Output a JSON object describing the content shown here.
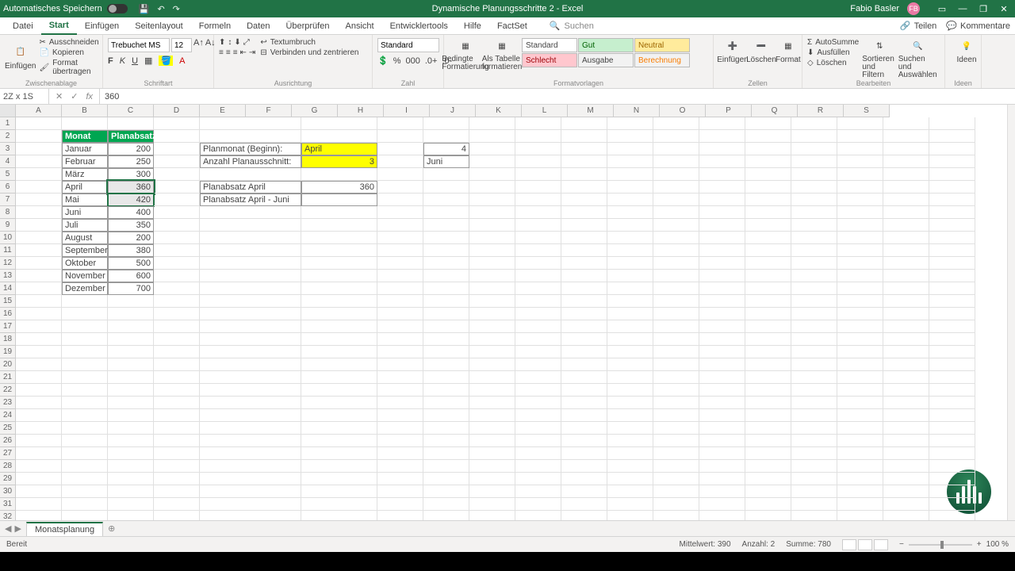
{
  "title": {
    "autosave": "Automatisches Speichern",
    "docname": "Dynamische Planungsschritte 2 - Excel",
    "user": "Fabio Basler",
    "avatar": "FB"
  },
  "tabs": {
    "datei": "Datei",
    "start": "Start",
    "einfuegen": "Einfügen",
    "seitenlayout": "Seitenlayout",
    "formeln": "Formeln",
    "daten": "Daten",
    "ueberpruefen": "Überprüfen",
    "ansicht": "Ansicht",
    "entwickler": "Entwicklertools",
    "hilfe": "Hilfe",
    "factset": "FactSet",
    "suchen": "Suchen",
    "teilen": "Teilen",
    "kommentare": "Kommentare"
  },
  "ribbon": {
    "clipboard": {
      "einfuegen": "Einfügen",
      "ausschneiden": "Ausschneiden",
      "kopieren": "Kopieren",
      "format": "Format übertragen",
      "label": "Zwischenablage"
    },
    "font": {
      "name": "Trebuchet MS",
      "size": "12",
      "label": "Schriftart"
    },
    "align": {
      "wrap": "Textumbruch",
      "merge": "Verbinden und zentrieren",
      "label": "Ausrichtung"
    },
    "number": {
      "format": "Standard",
      "label": "Zahl"
    },
    "styles": {
      "bedingte": "Bedingte Formatierung",
      "tabelle": "Als Tabelle formatieren",
      "std": "Standard",
      "gut": "Gut",
      "neutral": "Neutral",
      "schlecht": "Schlecht",
      "ausgabe": "Ausgabe",
      "berechnung": "Berechnung",
      "label": "Formatvorlagen"
    },
    "cells": {
      "einfuegen": "Einfügen",
      "loeschen": "Löschen",
      "format": "Format",
      "label": "Zellen"
    },
    "editing": {
      "summe": "AutoSumme",
      "ausfuellen": "Ausfüllen",
      "loeschen": "Löschen",
      "sort": "Sortieren und Filtern",
      "suchen": "Suchen und Auswählen",
      "label": "Bearbeiten"
    },
    "ideen": {
      "btn": "Ideen",
      "label": "Ideen"
    }
  },
  "fx": {
    "namebox": "2Z x 1S",
    "value": "360"
  },
  "columns": [
    "A",
    "B",
    "C",
    "D",
    "E",
    "F",
    "G",
    "H",
    "I",
    "J",
    "K",
    "L",
    "M",
    "N",
    "O",
    "P",
    "Q",
    "R",
    "S"
  ],
  "table": {
    "h1": "Monat",
    "h2": "Planabsatz",
    "rows": [
      {
        "m": "Januar",
        "v": "200"
      },
      {
        "m": "Februar",
        "v": "250"
      },
      {
        "m": "März",
        "v": "300"
      },
      {
        "m": "April",
        "v": "360"
      },
      {
        "m": "Mai",
        "v": "420"
      },
      {
        "m": "Juni",
        "v": "400"
      },
      {
        "m": "Juli",
        "v": "350"
      },
      {
        "m": "August",
        "v": "200"
      },
      {
        "m": "September",
        "v": "380"
      },
      {
        "m": "Oktober",
        "v": "500"
      },
      {
        "m": "November",
        "v": "600"
      },
      {
        "m": "Dezember",
        "v": "700"
      }
    ]
  },
  "side": {
    "planmonat_lbl": "Planmonat (Beginn):",
    "planmonat_val": "April",
    "anzahl_lbl": "Anzahl Planausschnitt:",
    "anzahl_val": "3",
    "h1": "4",
    "h2": "Juni",
    "pa1_lbl": "Planabsatz April",
    "pa1_val": "360",
    "pa2_lbl": "Planabsatz April - Juni"
  },
  "sheet": {
    "name": "Monatsplanung"
  },
  "status": {
    "ready": "Bereit",
    "avg": "Mittelwert: 390",
    "cnt": "Anzahl: 2",
    "sum": "Summe: 780",
    "zoom": "100 %"
  }
}
